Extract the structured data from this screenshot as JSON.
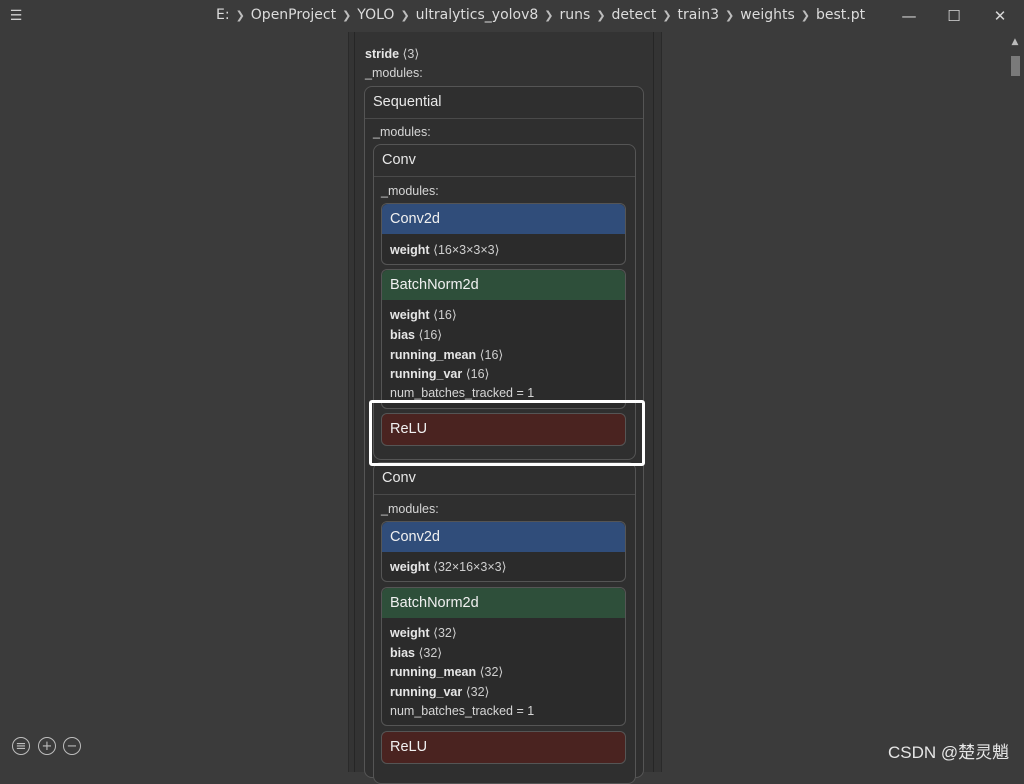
{
  "titlebar": {
    "path": [
      "E:",
      "OpenProject",
      "YOLO",
      "ultralytics_yolov8",
      "runs",
      "detect",
      "train3",
      "weights",
      "best.pt"
    ],
    "sep": "❯",
    "menu_glyph": "☰",
    "minimize_glyph": "—",
    "maximize_glyph": "☐",
    "close_glyph": "✕"
  },
  "top": {
    "stride_label": "stride",
    "stride_value": "⟨3⟩",
    "modules_label": "_modules:"
  },
  "sequential": {
    "title": "Sequential",
    "modules_label": "_modules:"
  },
  "conv1": {
    "title": "Conv",
    "modules_label": "_modules:",
    "conv2d": {
      "title": "Conv2d",
      "weight_label": "weight",
      "weight_value": "⟨16×3×3×3⟩"
    },
    "bn": {
      "title": "BatchNorm2d",
      "weight_label": "weight",
      "weight_value": "⟨16⟩",
      "bias_label": "bias",
      "bias_value": "⟨16⟩",
      "mean_label": "running_mean",
      "mean_value": "⟨16⟩",
      "var_label": "running_var",
      "var_value": "⟨16⟩",
      "num_batches": "num_batches_tracked = 1"
    },
    "relu": {
      "title": "ReLU"
    }
  },
  "conv2": {
    "title": "Conv",
    "modules_label": "_modules:",
    "conv2d": {
      "title": "Conv2d",
      "weight_label": "weight",
      "weight_value": "⟨32×16×3×3⟩"
    },
    "bn": {
      "title": "BatchNorm2d",
      "weight_label": "weight",
      "weight_value": "⟨32⟩",
      "bias_label": "bias",
      "bias_value": "⟨32⟩",
      "mean_label": "running_mean",
      "mean_value": "⟨32⟩",
      "var_label": "running_var",
      "var_value": "⟨32⟩",
      "num_batches": "num_batches_tracked = 1"
    },
    "relu": {
      "title": "ReLU"
    }
  },
  "tools": {
    "list_glyph": "≡",
    "zoom_in_glyph": "+",
    "zoom_out_glyph": "−"
  },
  "watermark": "CSDN @楚灵魈",
  "scrollbar": {
    "up_glyph": "▲"
  },
  "colors": {
    "conv2d": "#304d7a",
    "batchnorm": "#2e4f3a",
    "relu": "#4a2320",
    "background": "#3b3b3b"
  }
}
